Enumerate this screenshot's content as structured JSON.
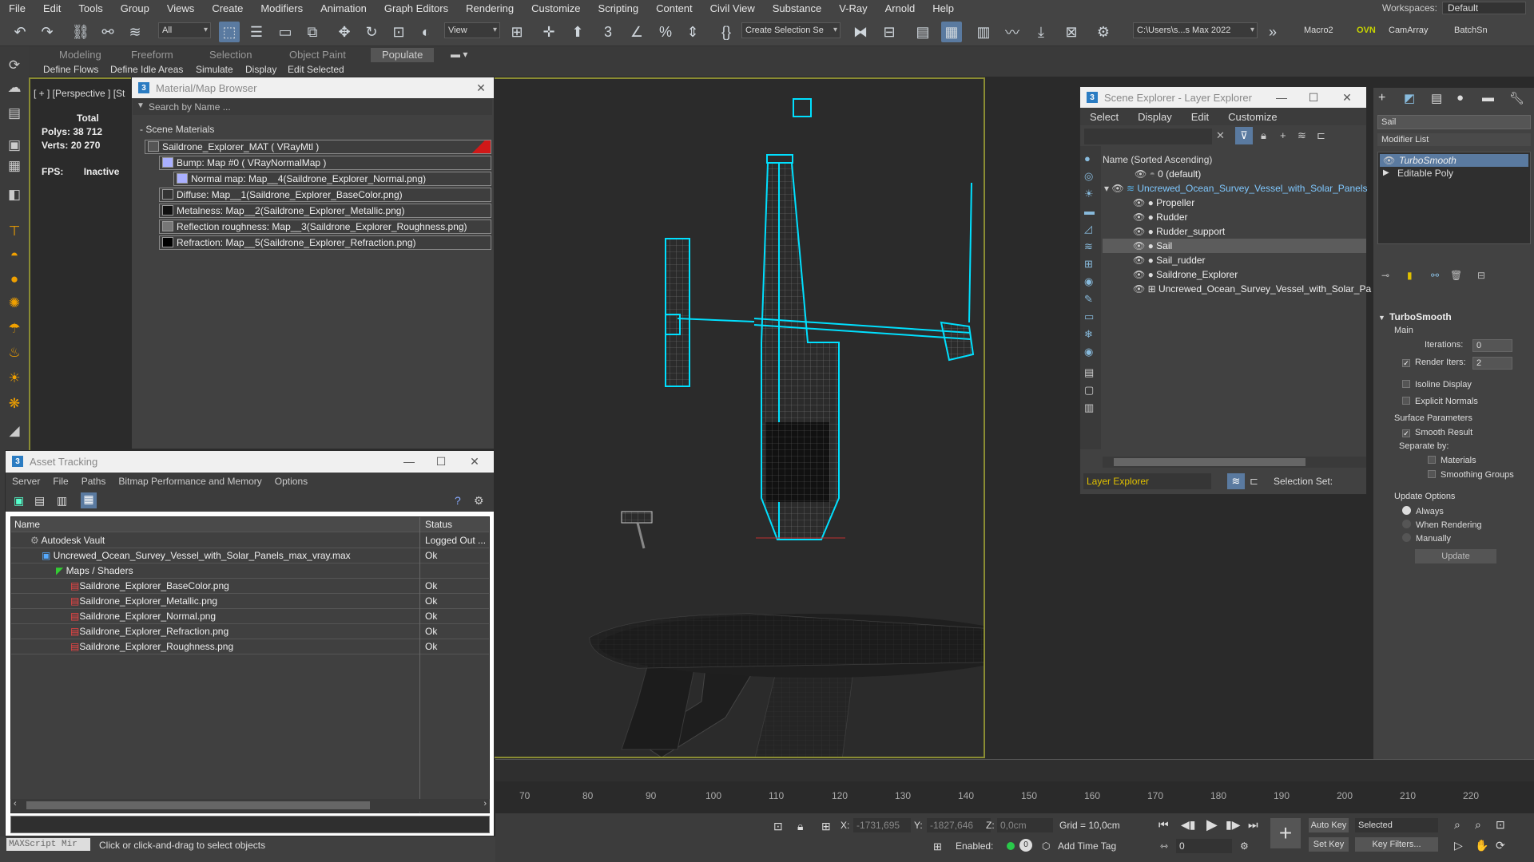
{
  "menu": {
    "items": [
      "File",
      "Edit",
      "Tools",
      "Group",
      "Views",
      "Create",
      "Modifiers",
      "Animation",
      "Graph Editors",
      "Rendering",
      "Customize",
      "Scripting",
      "Content",
      "Civil View",
      "Substance",
      "V-Ray",
      "Arnold",
      "Help"
    ],
    "workspace_label": "Workspaces:",
    "workspace_value": "Default"
  },
  "toolbar": {
    "filter": "All",
    "ref_coord": "View",
    "selection_set": "Create Selection Se",
    "path": "C:\\Users\\s...s Max 2022",
    "macro": "Macro2",
    "ovn": "OVN",
    "camarray": "CamArray",
    "batch": "BatchSn"
  },
  "ribbon": {
    "tabs": [
      "Modeling",
      "Freeform",
      "Selection",
      "Object Paint",
      "Populate"
    ],
    "active": "Populate",
    "subs": [
      "Define Flows",
      "Define Idle Areas",
      "Simulate",
      "Display",
      "Edit Selected"
    ]
  },
  "viewport": {
    "label": "[ + ] [Perspective ] [St",
    "stats": {
      "total": "Total",
      "polys_label": "Polys:",
      "polys": "38 712",
      "verts_label": "Verts:",
      "verts": "20 270",
      "fps_label": "FPS:",
      "fps": "Inactive"
    }
  },
  "material_browser": {
    "title": "Material/Map Browser",
    "search_placeholder": "Search by Name ...",
    "section": "- Scene Materials",
    "rows": [
      {
        "label": "Saildrone_Explorer_MAT  ( VRayMtl )",
        "swatch": "#555"
      },
      {
        "label": "Bump: Map #0  ( VRayNormalMap )",
        "swatch": "#aab0ff"
      },
      {
        "label": "Normal map: Map__4(Saildrone_Explorer_Normal.png)",
        "swatch": "#aab0ff"
      },
      {
        "label": "Diffuse: Map__1(Saildrone_Explorer_BaseColor.png)",
        "swatch": "#333"
      },
      {
        "label": "Metalness: Map__2(Saildrone_Explorer_Metallic.png)",
        "swatch": "#111"
      },
      {
        "label": "Reflection roughness: Map__3(Saildrone_Explorer_Roughness.png)",
        "swatch": "#777"
      },
      {
        "label": "Refraction: Map__5(Saildrone_Explorer_Refraction.png)",
        "swatch": "#000"
      }
    ]
  },
  "asset_tracking": {
    "title": "Asset Tracking",
    "menu": [
      "Server",
      "File",
      "Paths",
      "Bitmap Performance and Memory",
      "Options"
    ],
    "col_name": "Name",
    "col_status": "Status",
    "rows": [
      {
        "name": "Autodesk Vault",
        "status": "Logged Out ..."
      },
      {
        "name": "Uncrewed_Ocean_Survey_Vessel_with_Solar_Panels_max_vray.max",
        "status": "Ok"
      },
      {
        "name": "Maps / Shaders",
        "status": ""
      },
      {
        "name": "Saildrone_Explorer_BaseColor.png",
        "status": "Ok"
      },
      {
        "name": "Saildrone_Explorer_Metallic.png",
        "status": "Ok"
      },
      {
        "name": "Saildrone_Explorer_Normal.png",
        "status": "Ok"
      },
      {
        "name": "Saildrone_Explorer_Refraction.png",
        "status": "Ok"
      },
      {
        "name": "Saildrone_Explorer_Roughness.png",
        "status": "Ok"
      }
    ]
  },
  "maxscript": {
    "label": "MAXScript Mir",
    "prompt": "Click or click-and-drag to select objects"
  },
  "scene_explorer": {
    "title": "Scene Explorer - Layer Explorer",
    "menu": [
      "Select",
      "Display",
      "Edit",
      "Customize"
    ],
    "header": "Name (Sorted Ascending)",
    "items": [
      {
        "label": "0 (default)",
        "level": 0
      },
      {
        "label": "Uncrewed_Ocean_Survey_Vessel_with_Solar_Panels",
        "level": 0
      },
      {
        "label": "Propeller",
        "level": 1
      },
      {
        "label": "Rudder",
        "level": 1
      },
      {
        "label": "Rudder_support",
        "level": 1
      },
      {
        "label": "Sail",
        "level": 1
      },
      {
        "label": "Sail_rudder",
        "level": 1
      },
      {
        "label": "Saildrone_Explorer",
        "level": 1
      },
      {
        "label": "Uncrewed_Ocean_Survey_Vessel_with_Solar_Pa",
        "level": 1
      }
    ],
    "footer_dropdown": "Layer Explorer",
    "footer_selection": "Selection Set:"
  },
  "command_panel": {
    "object_name": "Sail",
    "modifier_list": "Modifier List",
    "stack": [
      "TurboSmooth",
      "Editable Poly"
    ],
    "rollout": "TurboSmooth",
    "main": "Main",
    "iterations_label": "Iterations:",
    "iterations": "0",
    "render_iters_label": "Render Iters:",
    "render_iters": "2",
    "isoline": "Isoline Display",
    "explicit": "Explicit Normals",
    "surface": "Surface Parameters",
    "smooth": "Smooth Result",
    "separate": "Separate by:",
    "materials": "Materials",
    "smoothing": "Smoothing Groups",
    "update_options": "Update Options",
    "always": "Always",
    "when_rendering": "When Rendering",
    "manually": "Manually",
    "update": "Update"
  },
  "timeline": {
    "ticks": [
      "70",
      "80",
      "90",
      "100",
      "110",
      "120",
      "130",
      "140",
      "150",
      "160",
      "170",
      "180",
      "190",
      "200",
      "210",
      "220"
    ]
  },
  "bottom": {
    "x_label": "X:",
    "x": "-1731,695",
    "y_label": "Y:",
    "y": "-1827,646",
    "z_label": "Z:",
    "z": "0,0cm",
    "grid": "Grid = 10,0cm",
    "enabled": "Enabled:",
    "add_time_tag": "Add Time Tag",
    "auto_key": "Auto Key",
    "set_key": "Set Key",
    "selected": "Selected",
    "key_filters": "Key Filters...",
    "frame": "0"
  }
}
